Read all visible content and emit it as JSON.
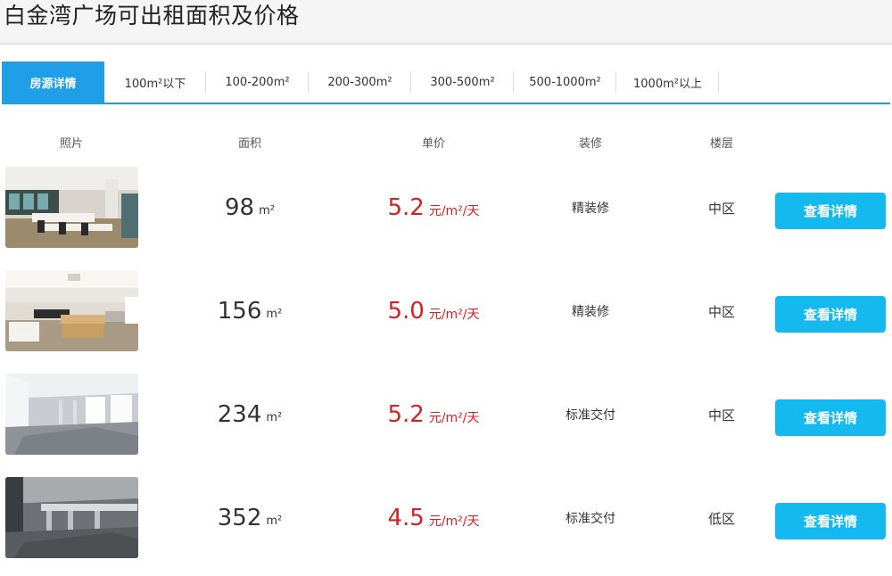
{
  "page": {
    "title": "白金湾广场可出租面积及价格"
  },
  "tabs": [
    {
      "label": "房源详情",
      "active": true
    },
    {
      "label": "100m²以下",
      "active": false
    },
    {
      "label": "100-200m²",
      "active": false
    },
    {
      "label": "200-300m²",
      "active": false
    },
    {
      "label": "300-500m²",
      "active": false
    },
    {
      "label": "500-1000m²",
      "active": false
    },
    {
      "label": "1000m²以上",
      "active": false
    }
  ],
  "columns": {
    "photo": "照片",
    "area": "面积",
    "price": "单价",
    "decoration": "装修",
    "floor": "楼层"
  },
  "colors": {
    "accent": "#1e9fe8",
    "button": "#14b9ef",
    "price": "#d42121"
  },
  "listings": [
    {
      "area": "98",
      "area_unit": "m²",
      "price": "5.2",
      "price_unit": "元/m²/天",
      "decoration": "精装修",
      "floor": "中区",
      "button": "查看详情",
      "photo_icon": "office-photo-icon"
    },
    {
      "area": "156",
      "area_unit": "m²",
      "price": "5.0",
      "price_unit": "元/m²/天",
      "decoration": "精装修",
      "floor": "中区",
      "button": "查看详情",
      "photo_icon": "office-photo-icon"
    },
    {
      "area": "234",
      "area_unit": "m²",
      "price": "5.2",
      "price_unit": "元/m²/天",
      "decoration": "标准交付",
      "floor": "中区",
      "button": "查看详情",
      "photo_icon": "office-photo-icon"
    },
    {
      "area": "352",
      "area_unit": "m²",
      "price": "4.5",
      "price_unit": "元/m²/天",
      "decoration": "标准交付",
      "floor": "低区",
      "button": "查看详情",
      "photo_icon": "office-photo-icon"
    }
  ]
}
